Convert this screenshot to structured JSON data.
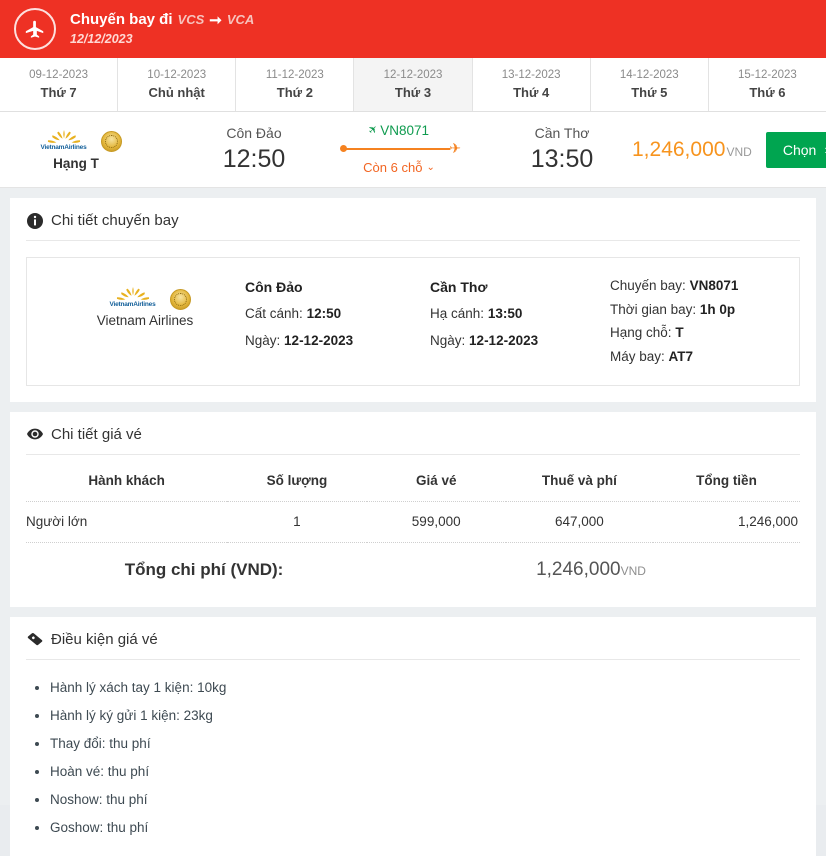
{
  "header": {
    "icon": "airplane-icon",
    "title": "Chuyến bay đi",
    "origin_code": "VCS",
    "arrow": "➞",
    "dest_code": "VCA",
    "date": "12/12/2023",
    "bg_color": "#ee3124"
  },
  "date_strip": {
    "items": [
      {
        "date": "09-12-2023",
        "day": "Thứ 7",
        "active": false
      },
      {
        "date": "10-12-2023",
        "day": "Chủ nhật",
        "active": false
      },
      {
        "date": "11-12-2023",
        "day": "Thứ 2",
        "active": false
      },
      {
        "date": "12-12-2023",
        "day": "Thứ 3",
        "active": true
      },
      {
        "date": "13-12-2023",
        "day": "Thứ 4",
        "active": false
      },
      {
        "date": "14-12-2023",
        "day": "Thứ 5",
        "active": false
      },
      {
        "date": "15-12-2023",
        "day": "Thứ 6",
        "active": false
      }
    ]
  },
  "summary": {
    "airline_logo_text": "VietnamAirlines",
    "class_label": "Hạng T",
    "departure": {
      "city": "Côn Đảo",
      "time": "12:50"
    },
    "arrival": {
      "city": "Cần Thơ",
      "time": "13:50"
    },
    "flight_number": "VN8071",
    "seats_left": "Còn 6 chỗ",
    "seats_caret": "⌄",
    "price": "1,246,000",
    "currency": "VND",
    "choose_label": "Chọn",
    "choose_chevron": "›",
    "price_color": "#f7941e",
    "button_color": "#00a550",
    "accent_orange": "#f26522",
    "flight_green": "#0f9b4f"
  },
  "flight_detail": {
    "section_title": "Chi tiết chuyến bay",
    "section_icon": "info-circle-icon",
    "airline_name": "Vietnam Airlines",
    "airline_logo_text": "VietnamAirlines",
    "departure": {
      "city": "Côn Đảo",
      "takeoff_label": "Cất cánh:",
      "takeoff_value": "12:50",
      "date_label": "Ngày:",
      "date_value": "12-12-2023"
    },
    "arrival": {
      "city": "Cần Thơ",
      "landing_label": "Hạ cánh:",
      "landing_value": "13:50",
      "date_label": "Ngày:",
      "date_value": "12-12-2023"
    },
    "info": {
      "flight_label": "Chuyến bay:",
      "flight_value": "VN8071",
      "duration_label": "Thời gian bay:",
      "duration_value": "1h 0p",
      "class_label": "Hạng chỗ:",
      "class_value": "T",
      "aircraft_label": "Máy bay:",
      "aircraft_value": "AT7"
    }
  },
  "price_detail": {
    "section_title": "Chi tiết giá vé",
    "section_icon": "eye-icon",
    "columns": [
      "Hành khách",
      "Số lượng",
      "Giá vé",
      "Thuế và phí",
      "Tổng tiền"
    ],
    "rows": [
      {
        "passenger": "Người lớn",
        "quantity": "1",
        "fare": "599,000",
        "tax": "647,000",
        "total": "1,246,000"
      }
    ],
    "grand_total_label": "Tổng chi phí (VND):",
    "grand_total_value": "1,246,000",
    "grand_total_currency": "VND"
  },
  "fare_conditions": {
    "section_title": "Điều kiện giá vé",
    "section_icon": "ticket-tag-icon",
    "items": [
      "Hành lý xách tay 1 kiện: 10kg",
      "Hành lý ký gửi 1 kiện: 23kg",
      "Thay đổi: thu phí",
      "Hoàn vé: thu phí",
      "Noshow: thu phí",
      "Goshow: thu phí"
    ]
  }
}
